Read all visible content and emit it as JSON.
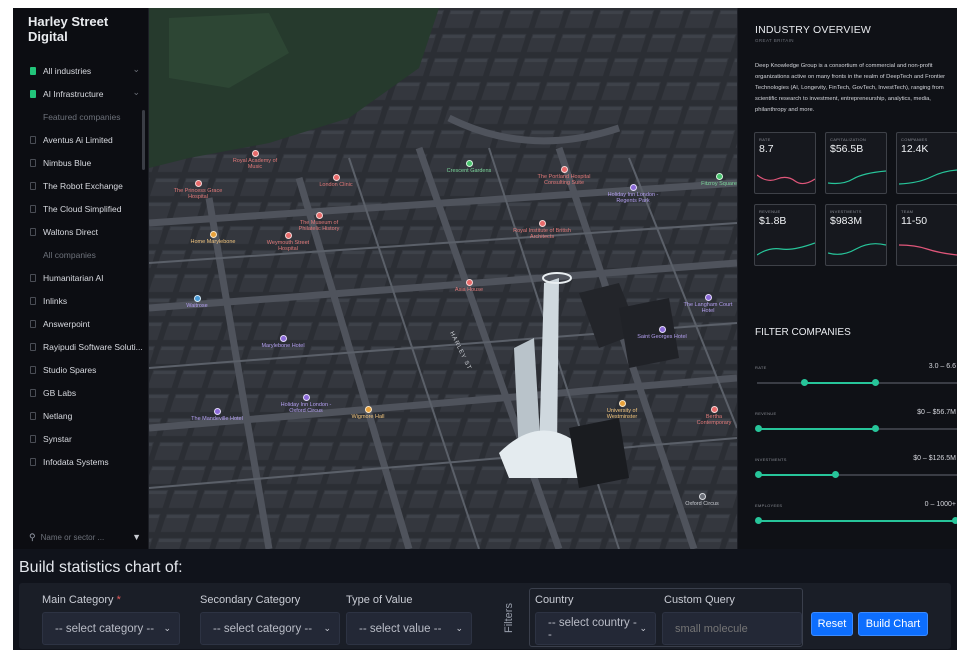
{
  "brand": "Harley Street Digital",
  "sidebar": {
    "items": [
      {
        "label": "All industries",
        "state": "checked"
      },
      {
        "label": "AI Infrastructure",
        "state": "checked"
      },
      {
        "label": "Featured companies",
        "state": "muted"
      },
      {
        "label": "Aventus Ai Limited",
        "state": "box"
      },
      {
        "label": "Nimbus Blue",
        "state": "box"
      },
      {
        "label": "The Robot Exchange",
        "state": "box"
      },
      {
        "label": "The Cloud Simplified",
        "state": "box"
      },
      {
        "label": "Waltons Direct",
        "state": "box"
      },
      {
        "label": "All companies",
        "state": "muted"
      },
      {
        "label": "Humanitarian AI",
        "state": "box"
      },
      {
        "label": "Inlinks",
        "state": "box"
      },
      {
        "label": "Answerpoint",
        "state": "box"
      },
      {
        "label": "Rayipudi Software Soluti...",
        "state": "box"
      },
      {
        "label": "Studio Spares",
        "state": "box"
      },
      {
        "label": "GB Labs",
        "state": "box"
      },
      {
        "label": "Netlang",
        "state": "box"
      },
      {
        "label": "Synstar",
        "state": "box"
      },
      {
        "label": "Infodata Systems",
        "state": "box"
      }
    ],
    "search_placeholder": "Name or sector ..."
  },
  "map": {
    "pois": [
      {
        "label": "Royal Academy of Music",
        "color": "red"
      },
      {
        "label": "The Princess Grace Hospital",
        "color": "red"
      },
      {
        "label": "London Clinic",
        "color": "red"
      },
      {
        "label": "Crescent Gardens",
        "color": "green"
      },
      {
        "label": "The Portland Hospital Consulting Suite",
        "color": "red"
      },
      {
        "label": "Holiday Inn London - Regents Park",
        "color": "purple"
      },
      {
        "label": "Fitzroy Square",
        "color": "green"
      },
      {
        "label": "The Museum of Philatelic History",
        "color": "red"
      },
      {
        "label": "Royal Institute of British Architects",
        "color": "red"
      },
      {
        "label": "Home Marylebone",
        "color": "orange"
      },
      {
        "label": "Weymouth Street Hospital",
        "color": "red"
      },
      {
        "label": "Asia House",
        "color": "red"
      },
      {
        "label": "Waitrose",
        "color": "blue"
      },
      {
        "label": "The Langham Court Hotel",
        "color": "purple"
      },
      {
        "label": "Marylebone Hotel",
        "color": "purple"
      },
      {
        "label": "Saint Georges Hotel",
        "color": "purple"
      },
      {
        "label": "Holiday Inn London - Oxford Circus",
        "color": "purple"
      },
      {
        "label": "Wigmore Hall",
        "color": "orange"
      },
      {
        "label": "The Mandeville Hotel",
        "color": "purple"
      },
      {
        "label": "University of Westminster",
        "color": "orange"
      },
      {
        "label": "Bertha Contemporary",
        "color": "red"
      },
      {
        "label": "Oxford Circus",
        "color": "gray"
      }
    ],
    "street_label": "HARLEY ST"
  },
  "overview": {
    "title": "INDUSTRY OVERVIEW",
    "subtitle": "GREAT BRITAIN",
    "description": "Deep Knowledge Group is a consortium of commercial and non-profit organizations active on many fronts in the realm of DeepTech and Frontier Technologies (AI, Longevity, FinTech, GovTech, InvestTech), ranging from scientific research to investment, entrepreneurship, analytics, media, philanthropy and more.",
    "stats": [
      {
        "label": "RATE",
        "value": "8.7"
      },
      {
        "label": "CAPITALIZATION",
        "value": "$56.5B"
      },
      {
        "label": "COMPANIES",
        "value": "12.4K"
      },
      {
        "label": "REVENUE",
        "value": "$1.8B"
      },
      {
        "label": "INVESTMENTS",
        "value": "$983M"
      },
      {
        "label": "TEAM",
        "value": "11-50"
      }
    ]
  },
  "filters": {
    "title": "FILTER COMPANIES",
    "sliders": [
      {
        "label": "RATE",
        "range": "3.0 – 6.6",
        "low": 0.23,
        "high": 0.6
      },
      {
        "label": "REVENUE",
        "range": "$0 – $56.7M",
        "low": 0.0,
        "high": 0.6
      },
      {
        "label": "INVESTMENTS",
        "range": "$0 – $126.5M",
        "low": 0.0,
        "high": 0.4
      },
      {
        "label": "EMPLOYEES",
        "range": "0 – 1000+",
        "low": 0.0,
        "high": 1.0
      }
    ]
  },
  "builder": {
    "title": "Build statistics chart of:",
    "main_category": {
      "label": "Main Category",
      "required_mark": "*",
      "value": "-- select category --"
    },
    "secondary_category": {
      "label": "Secondary Category",
      "value": "-- select category --"
    },
    "type_of_value": {
      "label": "Type of Value",
      "value": "-- select value --"
    },
    "filters_label": "Filters",
    "country": {
      "label": "Country",
      "value": "-- select country --"
    },
    "custom_query": {
      "label": "Custom Query",
      "placeholder": "small molecule"
    },
    "reset_label": "Reset",
    "build_label": "Build Chart"
  },
  "colors": {
    "accent_green": "#27c59a",
    "button_blue": "#0d6efd",
    "checkbox_green": "#22c47a"
  }
}
